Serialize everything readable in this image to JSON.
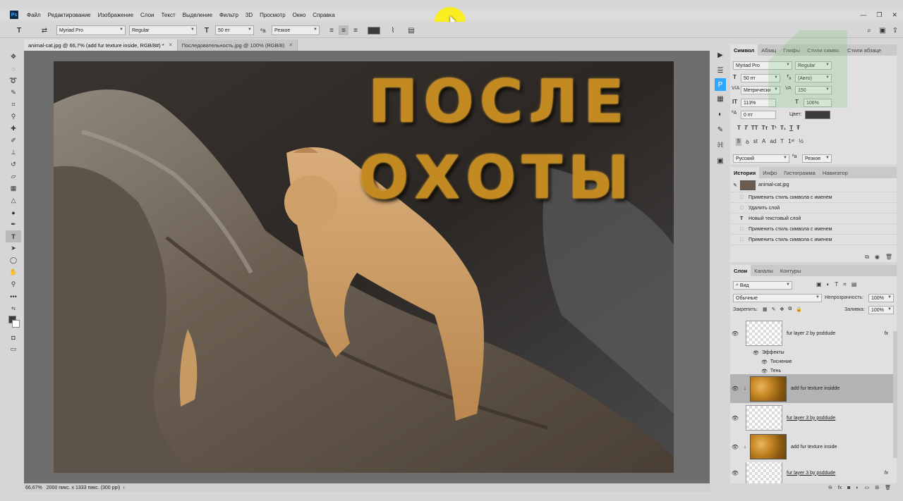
{
  "menu": {
    "logo": "Ps",
    "items": [
      "Файл",
      "Редактирование",
      "Изображение",
      "Слои",
      "Текст",
      "Выделение",
      "Фильтр",
      "3D",
      "Просмотр",
      "Окно",
      "Справка"
    ],
    "window_controls": [
      "—",
      "❐",
      "✕"
    ]
  },
  "options": {
    "font_family": "Myriad Pro",
    "font_style": "Regular",
    "font_size": "50 пт",
    "antialias": "Резкое"
  },
  "tabs": [
    {
      "label": "animal-cat.jpg @ 66,7% (add fur texture inside, RGB/8#) *"
    },
    {
      "label": "Последовательность.jpg @ 100% (RGB/8)"
    }
  ],
  "canvas": {
    "line1": "ПОСЛЕ",
    "line2": "ОХОТЫ"
  },
  "status": {
    "zoom": "66,67%",
    "info": "2000 пикс. x 1333 пикс. (300 ppi)"
  },
  "symbol_panel": {
    "tabs": [
      "Символ",
      "Абзац",
      "Глифы",
      "Стили симво.",
      "Стили абзаце"
    ],
    "font_family": "Myriad Pro",
    "font_style": "Regular",
    "size": "50 пт",
    "leading": "(Авто)",
    "kerning": "Метрически",
    "tracking": "150",
    "vscale": "113%",
    "hscale": "106%",
    "baseline": "0 пт",
    "color_label": "Цвет:",
    "color": "#3c3c3c",
    "language": "Русский",
    "antialias": "Резкое",
    "style_buttons": [
      "T",
      "T",
      "TT",
      "Tт",
      "T¹",
      "T₁",
      "T",
      "Ŧ"
    ],
    "opentype_buttons": [
      "fi",
      "ꝺ",
      "st",
      "A",
      "ad",
      "T",
      "1ˢᵗ",
      "½"
    ]
  },
  "history_panel": {
    "tabs": [
      "История",
      "Инфо",
      "Гистограмма",
      "Навигатор"
    ],
    "snapshot": "animal-cat.jpg",
    "items": [
      "Применить стиль символа с именем",
      "Удалить слой",
      "Новый текстовый слой",
      "Применить стиль символа с именем",
      "Применить стиль символа с именем"
    ]
  },
  "layers_panel": {
    "tabs": [
      "Слои",
      "Каналы",
      "Контуры"
    ],
    "filter": "Вид",
    "blend_mode": "Обычные",
    "opacity_label": "Непрозрачность:",
    "opacity": "100%",
    "lock_label": "Закрепить:",
    "fill_label": "Заливка:",
    "fill": "100%",
    "effects_label": "Эффекты",
    "effect1": "Тиснение",
    "effect2": "Тень",
    "fx": "fx",
    "layers": [
      {
        "name": "fur layer 2 by psddude"
      },
      {
        "name": "add fur texture insidde"
      },
      {
        "name": "fur layer 3 by psddude"
      },
      {
        "name": "add fur texture inside"
      },
      {
        "name": "fur layer 3 by psddude"
      }
    ]
  }
}
